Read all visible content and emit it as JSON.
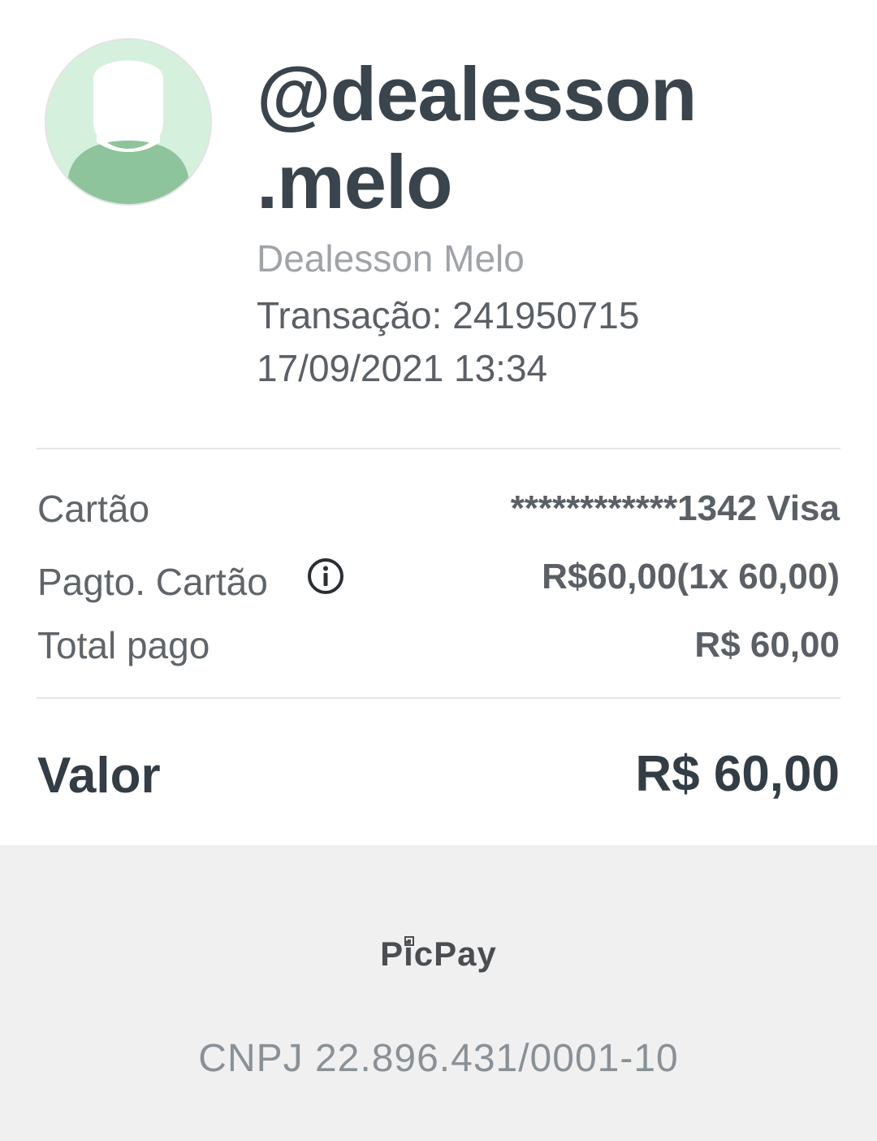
{
  "profile": {
    "username": "@dealesson .melo",
    "full_name": "Dealesson Melo",
    "transaction": "Transação: 241950715",
    "datetime": "17/09/2021 13:34"
  },
  "details": {
    "card_label": "Cartão",
    "card_value": "************1342 Visa",
    "payment_label": "Pagto. Cartão",
    "payment_value": "R$60,00(1x 60,00)",
    "total_label": "Total pago",
    "total_value": "R$ 60,00"
  },
  "summary": {
    "valor_label": "Valor",
    "valor_value": "R$ 60,00"
  },
  "footer": {
    "brand": "PicPay",
    "cnpj": "CNPJ 22.896.431/0001-10"
  },
  "icons": {
    "avatar": "avatar-placeholder-icon",
    "info": "info-icon"
  },
  "colors": {
    "avatar_bg": "#d6f0de",
    "avatar_body": "#8ec49b",
    "footer_bg": "#f0f0f0",
    "text_dark": "#333d45"
  }
}
